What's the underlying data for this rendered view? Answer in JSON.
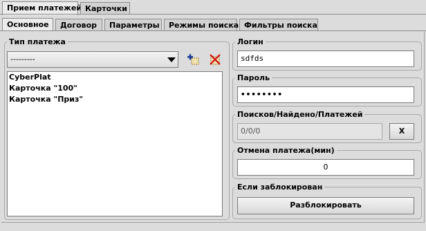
{
  "top_tabs": [
    {
      "label": "Прием платежей"
    },
    {
      "label": "Карточки"
    }
  ],
  "sub_tabs": [
    {
      "label": "Основное"
    },
    {
      "label": "Договор"
    },
    {
      "label": "Параметры"
    },
    {
      "label": "Режимы поиска"
    },
    {
      "label": "Фильтры поиска"
    }
  ],
  "payment_type": {
    "legend": "Тип платежа",
    "selected": "---------",
    "add_icon": "add-icon",
    "delete_icon": "delete-icon",
    "items": [
      "CyberPlat",
      "Карточка \"100\"",
      "Карточка \"Приз\""
    ]
  },
  "login": {
    "legend": "Логин",
    "value": "sdfds"
  },
  "password": {
    "legend": "Пароль",
    "value": "••••••••"
  },
  "counts": {
    "legend": "Поисков/Найдено/Платежей",
    "value": "0/0/0",
    "reset_label": "X"
  },
  "cancel": {
    "legend": "Отмена платежа(мин)",
    "value": "0"
  },
  "blocked": {
    "legend": "Если заблокирован",
    "unblock_label": "Разблокировать"
  }
}
